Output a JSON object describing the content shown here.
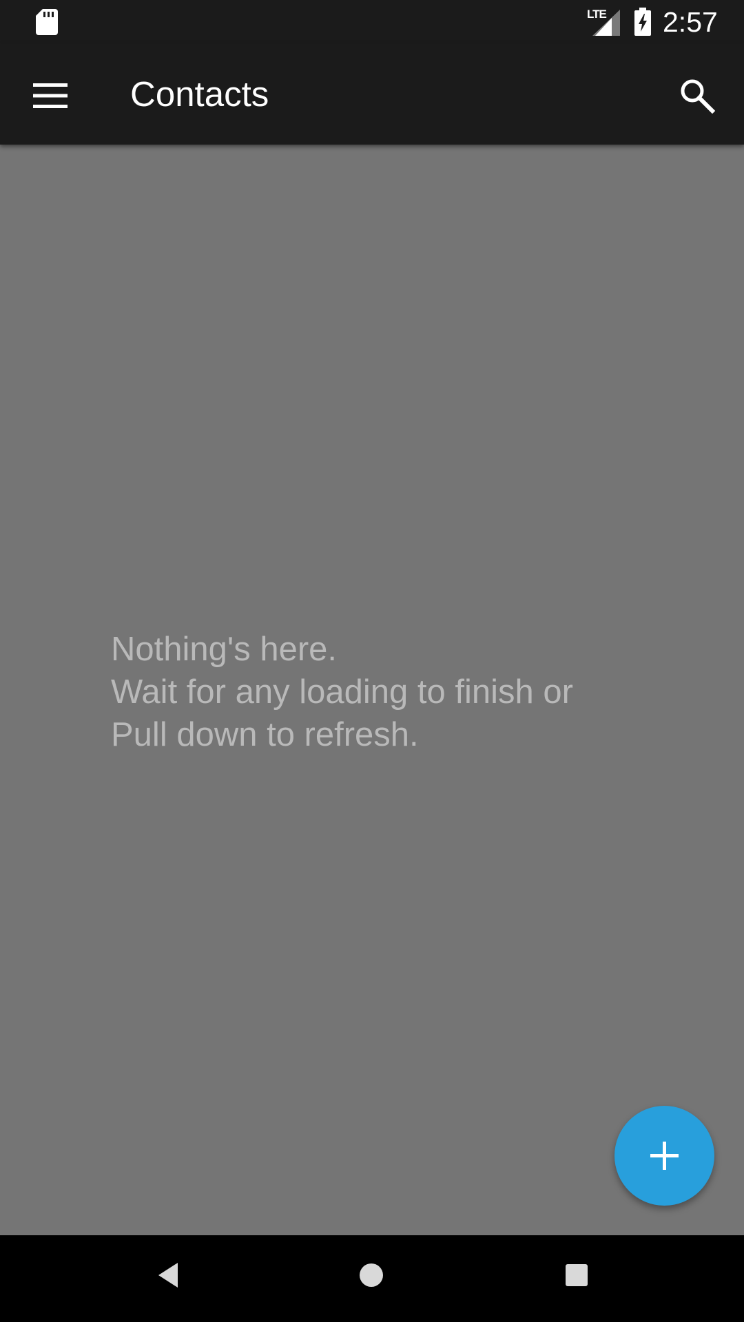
{
  "status_bar": {
    "time": "2:57",
    "network_label": "LTE",
    "icons": [
      "sd-card-icon",
      "signal-icon",
      "battery-charging-icon"
    ]
  },
  "app_bar": {
    "title": "Contacts",
    "menu_icon": "hamburger-menu-icon",
    "search_icon": "search-icon"
  },
  "empty_state": {
    "line1": "Nothing's here.",
    "line2": "Wait for any loading to finish or",
    "line3": "Pull down to refresh."
  },
  "fab": {
    "icon": "plus-icon",
    "color": "#289fdc"
  },
  "nav_bar": {
    "icons": [
      "back-icon",
      "home-icon",
      "recents-icon"
    ]
  },
  "colors": {
    "app_bar": "#1b1b1b",
    "content_background": "#757575",
    "empty_text": "#b9b9b9",
    "fab": "#289fdc"
  }
}
